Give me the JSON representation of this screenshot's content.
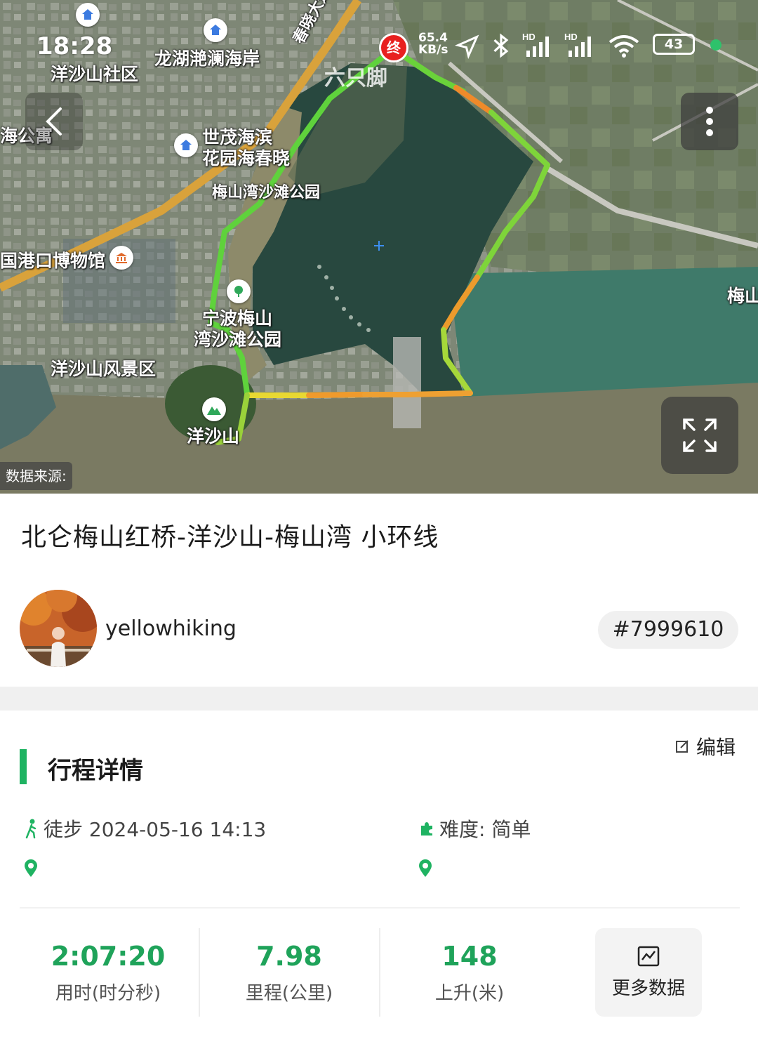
{
  "status_bar": {
    "time": "18:28",
    "net_speed_value": "65.4",
    "net_speed_unit": "KB/s",
    "battery": "43",
    "icons": [
      "location-arrow-icon",
      "bluetooth-icon",
      "hd-signal-icon",
      "hd-signal-icon",
      "wifi-icon",
      "battery-icon"
    ]
  },
  "map": {
    "watermark": "六只脚",
    "end_marker": "终",
    "data_source": "数据来源:",
    "labels": [
      "洋沙山社区",
      "龙湖滟澜海岸",
      "世茂海滨",
      "花园海春晓",
      "梅山湾沙滩公园",
      "国港口博物馆",
      "宁波梅山",
      "湾沙滩公园",
      "洋沙山风景区",
      "洋沙山",
      "梅山",
      "海公寓",
      "春晓大道"
    ],
    "colors": {
      "route_green": "#5fd23c",
      "route_yellow": "#e8d832",
      "route_orange": "#ef8a2a"
    }
  },
  "route": {
    "title": "北仑梅山红桥-洋沙山-梅山湾 小环线"
  },
  "author": {
    "username": "yellowhiking",
    "route_id": "#7999610"
  },
  "trip": {
    "section_title": "行程详情",
    "edit_label": "编辑",
    "activity": "徒步 2024-05-16 14:13",
    "difficulty": "难度: 简单",
    "stats": [
      {
        "value": "2:07:20",
        "label": "用时(时分秒)"
      },
      {
        "value": "7.98",
        "label": "里程(公里)"
      },
      {
        "value": "148",
        "label": "上升(米)"
      }
    ],
    "more_data_label": "更多数据",
    "accent_color": "#1fb362"
  }
}
